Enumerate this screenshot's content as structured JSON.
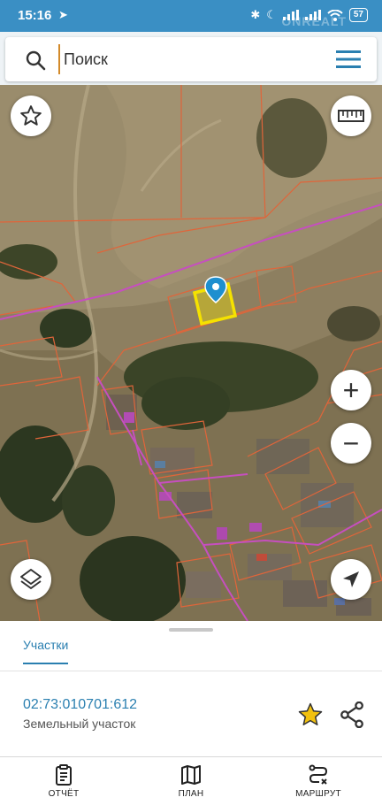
{
  "status_bar": {
    "time": "15:16",
    "battery": "57",
    "watermark": "ONREALT"
  },
  "search": {
    "placeholder": "Поиск"
  },
  "map": {
    "favorites_icon": "star-outline-icon",
    "ruler_icon": "ruler-icon",
    "zoom_in_label": "+",
    "zoom_out_label": "−",
    "layers_icon": "layers-icon",
    "locate_icon": "navigation-arrow-icon",
    "highlight_color": "#f5e200",
    "boundary_color": "#e0653a",
    "road_color": "#c64fbf",
    "pin_color": "#1e8fcf"
  },
  "sheet": {
    "tab_label": "Участки",
    "parcel_id": "02:73:010701:612",
    "parcel_type": "Земельный участок",
    "star_color": "#f2c10f"
  },
  "bottom_nav": {
    "report_label": "ОТЧЁТ",
    "plan_label": "ПЛАН",
    "route_label": "МАРШРУТ"
  }
}
